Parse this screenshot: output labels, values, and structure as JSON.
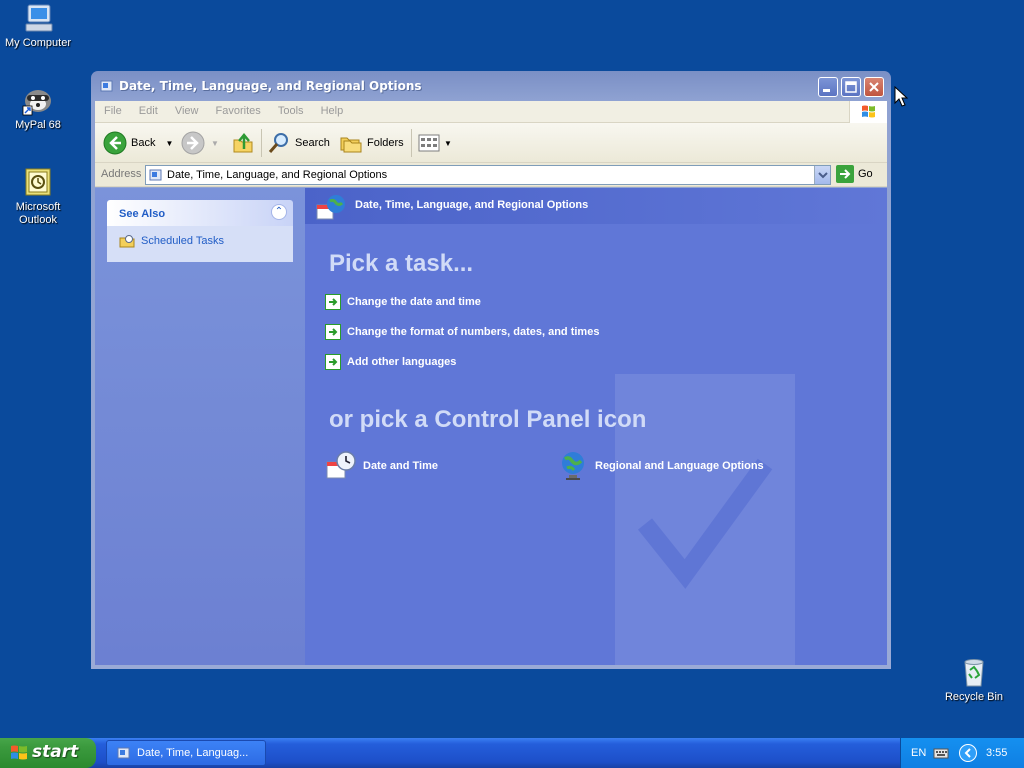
{
  "desktop": {
    "icons": [
      {
        "label": "My Computer"
      },
      {
        "label": "MyPal 68"
      },
      {
        "label": "Microsoft Outlook"
      },
      {
        "label": "Recycle Bin"
      }
    ]
  },
  "window": {
    "title": "Date, Time, Language, and Regional Options",
    "menu": [
      "File",
      "Edit",
      "View",
      "Favorites",
      "Tools",
      "Help"
    ],
    "toolbar": {
      "back": "Back",
      "search": "Search",
      "folders": "Folders"
    },
    "address": {
      "label": "Address",
      "value": "Date, Time, Language, and Regional Options",
      "go": "Go"
    },
    "left_pane": {
      "see_also_title": "See Also",
      "see_also_items": [
        "Scheduled Tasks"
      ]
    },
    "main_pane": {
      "header_title": "Date, Time, Language, and Regional Options",
      "pick_task_heading": "Pick a task...",
      "tasks": [
        "Change the date and time",
        "Change the format of numbers, dates, and times",
        "Add other languages"
      ],
      "pick_icon_heading": "or pick a Control Panel icon",
      "icons": [
        "Date and Time",
        "Regional and Language Options"
      ]
    }
  },
  "taskbar": {
    "start_label": "start",
    "task_button": "Date, Time, Languag...",
    "language": "EN",
    "clock": "3:55"
  },
  "colors": {
    "desktop": "#0a4a9c",
    "main_pane": "#6077d7",
    "taskbar": "#245edb",
    "start_button": "#3b9a3e"
  }
}
